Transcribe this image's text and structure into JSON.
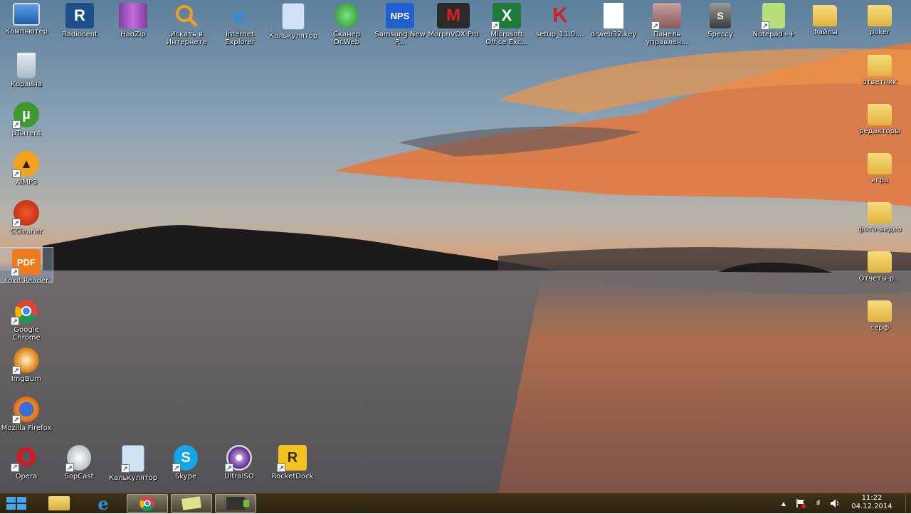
{
  "desktop": {
    "icons": [
      {
        "label": "Компьютер"
      },
      {
        "label": "Radiocent"
      },
      {
        "label": "HaoZip"
      },
      {
        "label": "Искать в Интернете"
      },
      {
        "label": "Internet Explorer"
      },
      {
        "label": "Калькулятор"
      },
      {
        "label": "Сканер Dr.Web"
      },
      {
        "label": "Samsung New P..."
      },
      {
        "label": "MorphVOX Pro"
      },
      {
        "label": "Microsoft Office Exc..."
      },
      {
        "label": "setup_11.0...."
      },
      {
        "label": "drweb32.key"
      },
      {
        "label": "Панель управлен..."
      },
      {
        "label": "Speccy"
      },
      {
        "label": "Notepad++"
      },
      {
        "label": "Файлы"
      },
      {
        "label": "poker"
      },
      {
        "label": "Корзина"
      },
      {
        "label": "µTorrent"
      },
      {
        "label": "AIMP3"
      },
      {
        "label": "CCleaner"
      },
      {
        "label": "Foxit Reader"
      },
      {
        "label": "Google Chrome"
      },
      {
        "label": "ImgBurn"
      },
      {
        "label": "Mozilla Firefox"
      },
      {
        "label": "Opera"
      },
      {
        "label": "SopCast"
      },
      {
        "label": "Калькулятор"
      },
      {
        "label": "Skype"
      },
      {
        "label": "UltraISO"
      },
      {
        "label": "RocketDock"
      },
      {
        "label": "ответник"
      },
      {
        "label": "редакторы"
      },
      {
        "label": "игра"
      },
      {
        "label": "фото-видео"
      },
      {
        "label": "Отчеты-р..."
      },
      {
        "label": "серф"
      }
    ],
    "glyph_text": {
      "radiocent": "R",
      "nps": "NPS",
      "morph": "M",
      "excel": "X",
      "kaspersky": "K",
      "opera": "O",
      "rocketdock": "R",
      "foxit": "PDF",
      "speccy": "S"
    }
  },
  "taskbar": {
    "clock": {
      "time": "11:22",
      "date": "04.12.2014"
    },
    "pinned": [
      "windows-start",
      "explorer",
      "internet-explorer",
      "chrome",
      "sticky-notes",
      "media-player"
    ],
    "tray_arrow": "▲",
    "tray_signal": "ıll"
  },
  "colors": {
    "taskbar": "#342a14",
    "accent": "#1e90ff"
  }
}
